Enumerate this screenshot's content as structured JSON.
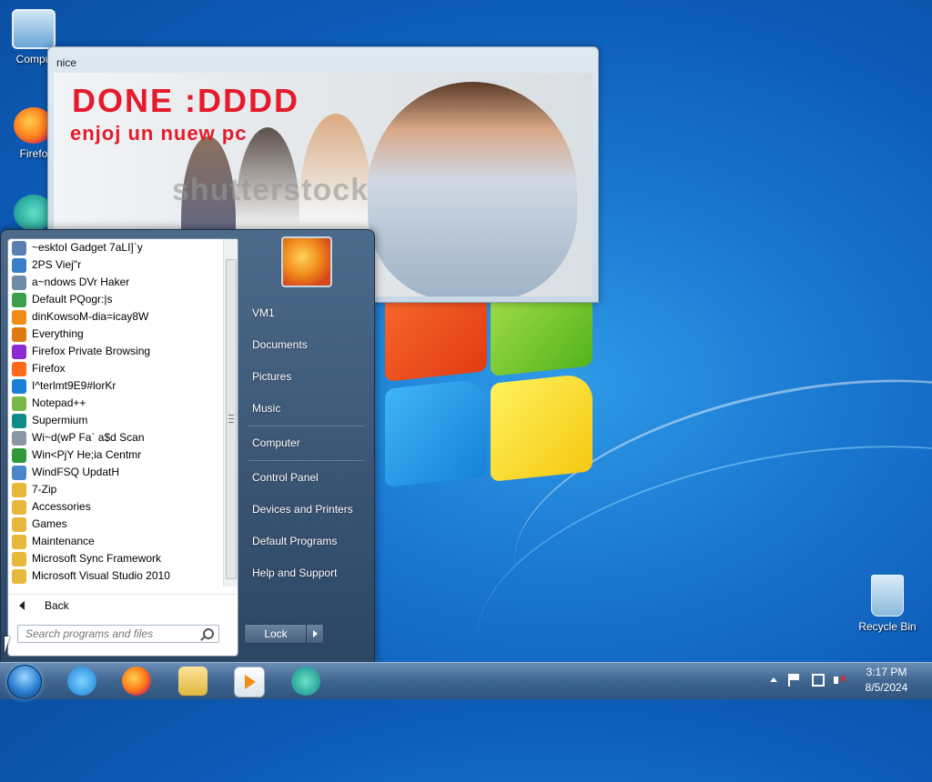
{
  "desktop": {
    "icons": [
      {
        "label": "Compu"
      },
      {
        "label": "Firefo"
      },
      {
        "label": ""
      }
    ],
    "recycle_bin_label": "Recycle Bin"
  },
  "nice_window": {
    "title": "nice",
    "image_text_1": "DONE :DDDD",
    "image_text_2": "enjoj un nuew pc",
    "watermark": "shutterstock"
  },
  "start_menu": {
    "programs": [
      {
        "label": "~esktoI Gadget 7aLI]`y",
        "icon": "gadget-icon",
        "color": "#5b7fb0"
      },
      {
        "label": "2PS Viej\"r",
        "icon": "xps-viewer-icon",
        "color": "#3a7dc8"
      },
      {
        "label": "a~ndows DVr Haker",
        "icon": "dvd-maker-icon",
        "color": "#6e8aa4"
      },
      {
        "label": "Default PQogr:|s",
        "icon": "default-programs-icon",
        "color": "#3aa04a"
      },
      {
        "label": "dinKowsoM-dia=icay8W",
        "icon": "media-player-icon",
        "color": "#f08c16"
      },
      {
        "label": "Everything",
        "icon": "everything-icon",
        "color": "#e07a10"
      },
      {
        "label": "Firefox Private Browsing",
        "icon": "firefox-private-icon",
        "color": "#8a2ad0"
      },
      {
        "label": "Firefox",
        "icon": "firefox-icon",
        "color": "#ff6a1a"
      },
      {
        "label": "I^terlmt9E9#lorKr",
        "icon": "internet-explorer-icon",
        "color": "#1a7fd6"
      },
      {
        "label": "Notepad++",
        "icon": "notepad-plus-plus-icon",
        "color": "#7ab648"
      },
      {
        "label": "Supermium",
        "icon": "supermium-icon",
        "color": "#0f8a86"
      },
      {
        "label": "Wi~d(wP Fa` a$d Scan",
        "icon": "fax-scan-icon",
        "color": "#8a96a4"
      },
      {
        "label": "Win<PjY He;ia Centmr",
        "icon": "media-center-icon",
        "color": "#2f9a3a"
      },
      {
        "label": "WindFSQ UpdatH",
        "icon": "windows-update-icon",
        "color": "#4a86c8"
      },
      {
        "label": "7-Zip",
        "icon": "folder-icon",
        "color": "#e8b83a"
      },
      {
        "label": "Accessories",
        "icon": "folder-icon",
        "color": "#e8b83a"
      },
      {
        "label": "Games",
        "icon": "folder-icon",
        "color": "#e8b83a"
      },
      {
        "label": "Maintenance",
        "icon": "folder-icon",
        "color": "#e8b83a"
      },
      {
        "label": "Microsoft Sync Framework",
        "icon": "folder-icon",
        "color": "#e8b83a"
      },
      {
        "label": "Microsoft Visual Studio 2010",
        "icon": "folder-icon",
        "color": "#e8b83a"
      }
    ],
    "back_label": "Back",
    "search_placeholder": "Search programs and files",
    "right_items": {
      "user": "VM1",
      "documents": "Documents",
      "pictures": "Pictures",
      "music": "Music",
      "computer": "Computer",
      "control_panel": "Control Panel",
      "devices": "Devices and Printers",
      "default_programs": "Default Programs",
      "help": "Help and Support"
    },
    "lock_label": "Lock"
  },
  "taskbar": {
    "clock_time": "3:17 PM",
    "clock_date": "8/5/2024"
  }
}
